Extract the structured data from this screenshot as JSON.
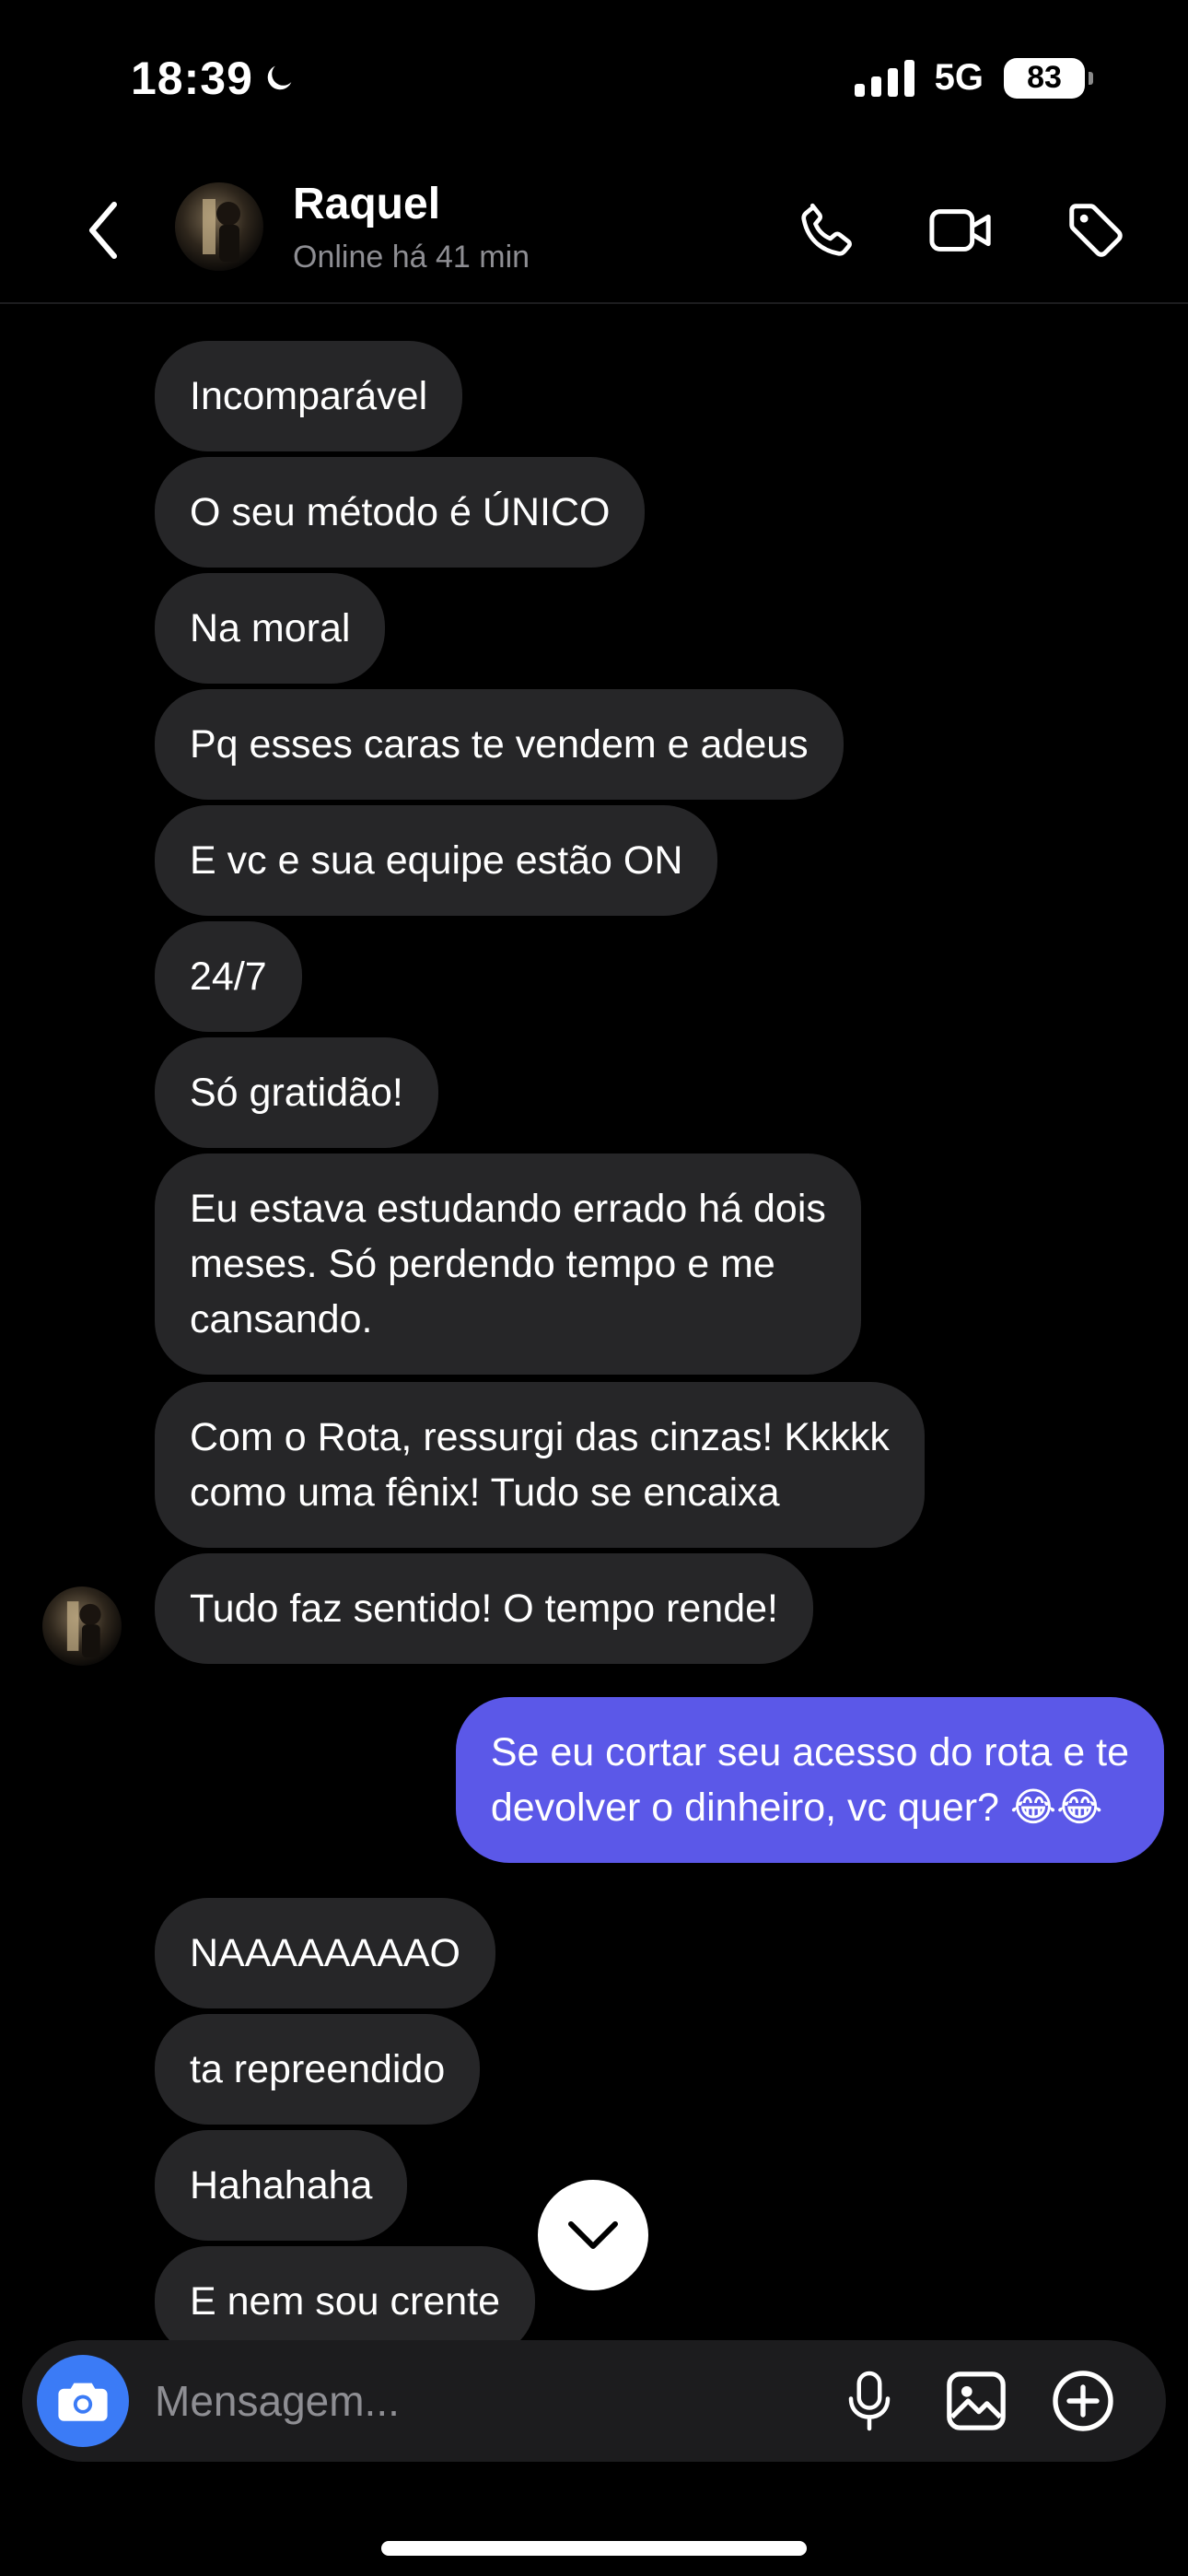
{
  "status_bar": {
    "time": "18:39",
    "network": "5G",
    "battery": "83",
    "moon_icon": "moon-icon"
  },
  "header": {
    "back_icon": "chevron-left-icon",
    "name": "Raquel",
    "status": "Online há 41 min",
    "actions": [
      "phone-icon",
      "video-icon",
      "tag-icon"
    ]
  },
  "messages": [
    {
      "from": "contact",
      "text": "Incomparável"
    },
    {
      "from": "contact",
      "text": "O seu método é ÚNICO"
    },
    {
      "from": "contact",
      "text": "Na moral"
    },
    {
      "from": "contact",
      "text": "Pq esses caras te vendem e adeus"
    },
    {
      "from": "contact",
      "text": "E vc e sua equipe estão ON"
    },
    {
      "from": "contact",
      "text": "24/7"
    },
    {
      "from": "contact",
      "text": "Só gratidão!"
    },
    {
      "from": "contact",
      "text": "Eu estava estudando errado há dois\nmeses. Só perdendo tempo e me\ncansando."
    },
    {
      "from": "contact",
      "text": "Com o Rota, ressurgi das cinzas! Kkkkk\ncomo uma fênix! Tudo se encaixa"
    },
    {
      "from": "contact",
      "text": "Tudo faz sentido! O tempo rende!"
    },
    {
      "from": "me",
      "text": "Se eu cortar seu acesso do rota e te\ndevolver o dinheiro, vc quer? 😂😂"
    },
    {
      "from": "contact",
      "text": "NAAAAAAAAO"
    },
    {
      "from": "contact",
      "text": "ta repreendido"
    },
    {
      "from": "contact",
      "text": "Hahahaha"
    },
    {
      "from": "contact",
      "text": "E nem sou crente"
    }
  ],
  "composer": {
    "placeholder": "Mensagem...",
    "icons": [
      "camera-icon",
      "microphone-icon",
      "image-icon",
      "plus-circle-icon"
    ]
  },
  "colors": {
    "background": "#000000",
    "incoming_bubble": "#262628",
    "outgoing_bubble": "#5b58e8",
    "camera_button": "#3b7bf6",
    "muted_text": "#8e8e93"
  }
}
